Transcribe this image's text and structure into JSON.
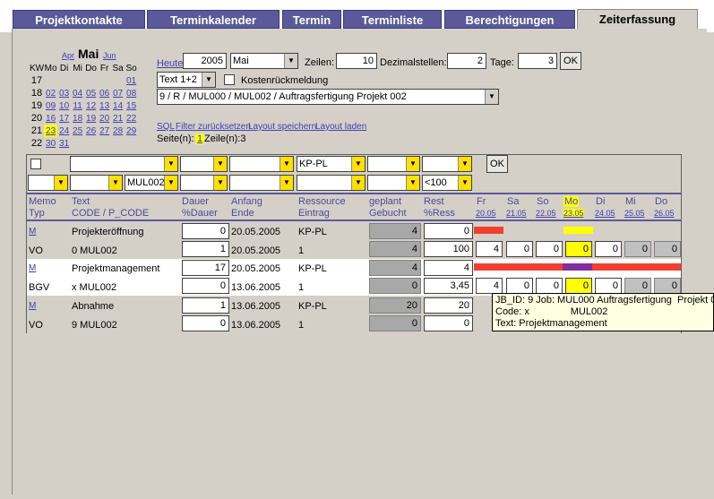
{
  "tabs": [
    "Projektkontakte",
    "Terminkalender",
    "Termin",
    "Terminliste",
    "Berechtigungen",
    "Zeiterfassung"
  ],
  "calendar": {
    "prev": "Apr",
    "month": "Mai",
    "next": "Jun",
    "head": [
      "KW",
      "Mo",
      "Di",
      "Mi",
      "Do",
      "Fr",
      "Sa",
      "So"
    ],
    "rows": [
      [
        "17",
        "",
        "",
        "",
        "",
        "",
        "",
        "01"
      ],
      [
        "18",
        "02",
        "03",
        "04",
        "05",
        "06",
        "07",
        "08"
      ],
      [
        "19",
        "09",
        "10",
        "11",
        "12",
        "13",
        "14",
        "15"
      ],
      [
        "20",
        "16",
        "17",
        "18",
        "19",
        "20",
        "21",
        "22"
      ],
      [
        "21",
        "23",
        "24",
        "25",
        "26",
        "27",
        "28",
        "29"
      ],
      [
        "22",
        "30",
        "31",
        "",
        "",
        "",
        "",
        ""
      ]
    ]
  },
  "filter": {
    "heute": "Heute",
    "year": "2005",
    "month": "Mai",
    "zeilen_label": "Zeilen:",
    "zeilen": "10",
    "dezimal_label": "Dezimalstellen:",
    "dezimal": "2",
    "tage_label": "Tage:",
    "tage": "3",
    "ok": "OK",
    "text_mode": "Text 1+2",
    "kosten": "Kostenrückmeldung",
    "project": "9 / R / MUL000 / MUL002 / Auftragsfertigung Projekt 002"
  },
  "links": {
    "sql": "SQL",
    "reset": "Filter zurücksetzen",
    "save": "Layout speichern",
    "load": "Layout laden"
  },
  "paging": {
    "seiten": "Seite(n):",
    "page": "1",
    "zeilen": "Zeile(n):3"
  },
  "flt": {
    "kp": "KP-PL",
    "mul": "MUL002",
    "lt": "<100",
    "ok": "OK"
  },
  "cols": {
    "memo": "Memo",
    "typ": "Typ",
    "text": "Text",
    "code": "CODE / P_CODE",
    "dauer": "Dauer",
    "pdauer": "%Dauer",
    "anfang": "Anfang",
    "ende": "Ende",
    "ress": "Ressource",
    "eintrag": "Eintrag",
    "geplant": "geplant",
    "gebucht": "Gebucht",
    "rest": "Rest",
    "press": "%Ress",
    "days": [
      {
        "d": "Fr",
        "dt": "20.05"
      },
      {
        "d": "Sa",
        "dt": "21.05"
      },
      {
        "d": "So",
        "dt": "22.05"
      },
      {
        "d": "Mo",
        "dt": "23.05"
      },
      {
        "d": "Di",
        "dt": "24.05"
      },
      {
        "d": "Mi",
        "dt": "25.05"
      },
      {
        "d": "Do",
        "dt": "26.05"
      }
    ]
  },
  "rows": [
    {
      "m": "M",
      "typ": "VO",
      "text": "Projekteröffnung",
      "code": "0 MUL002",
      "dauer": "0",
      "pdauer": "1",
      "anfang": "20.05.2005",
      "ende": "20.05.2005",
      "ress": "KP-PL",
      "eintrag": "1",
      "geplant": "4",
      "gebucht": "4",
      "rest": "0",
      "press": "100",
      "cells": [
        "4",
        "0",
        "0",
        "0",
        "0",
        "0",
        "0"
      ]
    },
    {
      "m": "M",
      "typ": "BGV",
      "text": "Projektmanagement",
      "code": "x MUL002",
      "dauer": "17",
      "pdauer": "0",
      "anfang": "20.05.2005",
      "ende": "13.06.2005",
      "ress": "KP-PL",
      "eintrag": "1",
      "geplant": "4",
      "gebucht": "0",
      "rest": "4",
      "press": "3,45",
      "cells": [
        "4",
        "0",
        "0",
        "0",
        "0",
        "0",
        "0"
      ]
    },
    {
      "m": "M",
      "typ": "VO",
      "text": "Abnahme",
      "code": "9 MUL002",
      "dauer": "1",
      "pdauer": "0",
      "anfang": "13.06.2005",
      "ende": "13.06.2005",
      "ress": "KP-PL",
      "eintrag": "1",
      "geplant": "20",
      "gebucht": "0",
      "rest": "20",
      "press": "0",
      "cells": []
    }
  ],
  "tooltip": "JB_ID: 9 Job: MUL000 Auftragsfertigung  Projekt 0\nCode: x               MUL002\nText: Projektmanagement",
  "colors": {
    "tab": "#5a5a9a",
    "bar_red": "#f04030",
    "bar_purple": "#8030a0",
    "highlight": "#ffff00"
  }
}
